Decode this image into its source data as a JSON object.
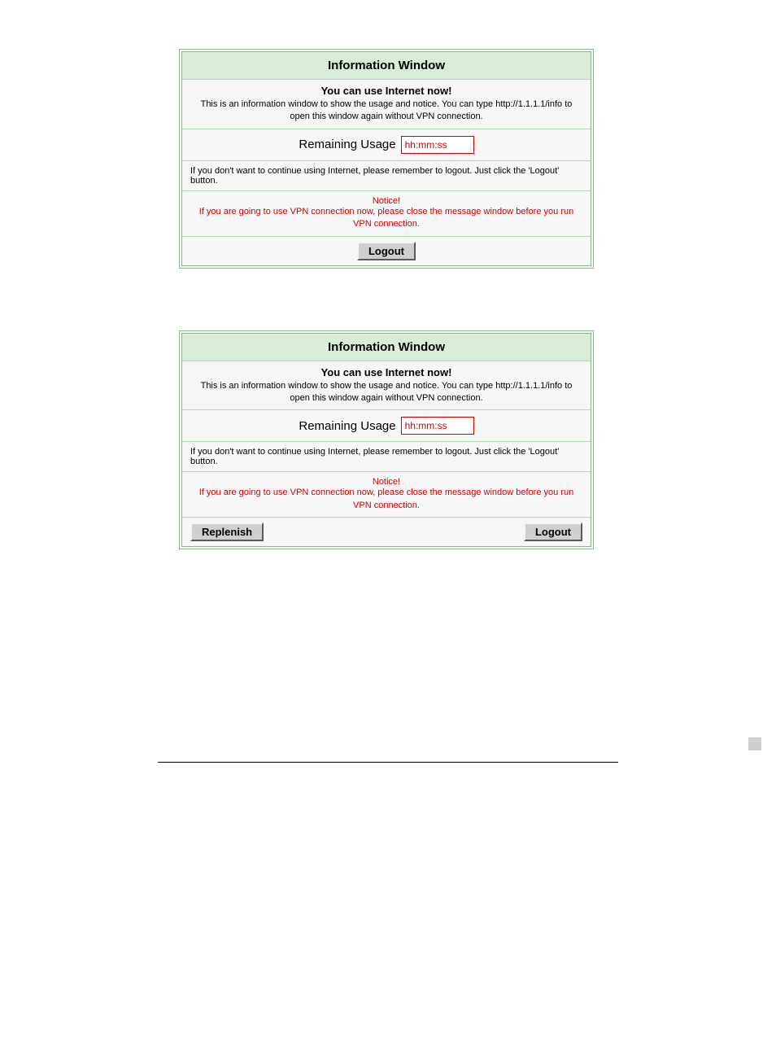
{
  "panel1": {
    "title": "Information Window",
    "headline": "You can use Internet now!",
    "description": "This is an information window to show the usage and notice. You can type http://1.1.1.1/info to open this window again without VPN connection.",
    "usage_label": "Remaining Usage",
    "usage_value": "hh:mm:ss",
    "logout_hint": "If you don't want to continue using Internet, please remember to logout. Just click the 'Logout' button.",
    "notice_title": "Notice!",
    "notice_body": "If you are going to use VPN connection now, please close the message window before you run VPN connection.",
    "logout_button": "Logout"
  },
  "panel2": {
    "title": "Information Window",
    "headline": "You can use Internet now!",
    "description": "This is an information window to show the usage and notice. You can type http://1.1.1.1/info to open this window again without VPN connection.",
    "usage_label": "Remaining Usage",
    "usage_value": "hh:mm:ss",
    "logout_hint": "If you don't want to continue using Internet, please remember to logout. Just click the 'Logout' button.",
    "notice_title": "Notice!",
    "notice_body": "If you are going to use VPN connection now, please close the message window before you run VPN connection.",
    "replenish_button": "Replenish",
    "logout_button": "Logout"
  }
}
